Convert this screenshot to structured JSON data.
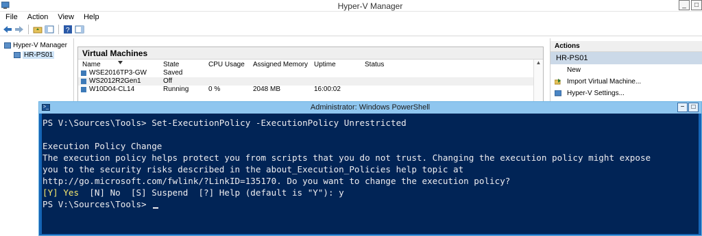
{
  "hyperv": {
    "title": "Hyper-V Manager",
    "menu": [
      "File",
      "Action",
      "View",
      "Help"
    ],
    "tree": {
      "root": "Hyper-V Manager",
      "server": "HR-PS01"
    },
    "vm_panel": {
      "header": "Virtual Machines",
      "columns": [
        "Name",
        "State",
        "CPU Usage",
        "Assigned Memory",
        "Uptime",
        "Status"
      ],
      "rows": [
        {
          "name": "WSE2016TP3-GW",
          "state": "Saved",
          "cpu": "",
          "memory": "",
          "uptime": "",
          "status": ""
        },
        {
          "name": "WS2012R2Gen1",
          "state": "Off",
          "cpu": "",
          "memory": "",
          "uptime": "",
          "status": ""
        },
        {
          "name": "W10D04-CL14",
          "state": "Running",
          "cpu": "0 %",
          "memory": "2048 MB",
          "uptime": "16:00:02",
          "status": ""
        }
      ]
    },
    "actions": {
      "header": "Actions",
      "server": "HR-PS01",
      "items": [
        "New",
        "Import Virtual Machine...",
        "Hyper-V Settings..."
      ]
    }
  },
  "powershell": {
    "title": "Administrator: Windows PowerShell",
    "lines": [
      "PS V:\\Sources\\Tools> Set-ExecutionPolicy -ExecutionPolicy Unrestricted",
      "",
      "Execution Policy Change",
      "The execution policy helps protect you from scripts that you do not trust. Changing the execution policy might expose",
      "you to the security risks described in the about_Execution_Policies help topic at",
      "http://go.microsoft.com/fwlink/?LinkID=135170. Do you want to change the execution policy?"
    ],
    "prompt_choice_yes": "[Y] Yes",
    "prompt_choice_rest": "  [N] No  [S] Suspend  [?] Help (default is \"Y\"): y",
    "final_prompt": "PS V:\\Sources\\Tools> "
  },
  "colors": {
    "console_bg": "#012456",
    "console_fg": "#eeedf0",
    "console_yellow": "#f5e86e",
    "ps_titlebar": "#8fc6ef"
  }
}
